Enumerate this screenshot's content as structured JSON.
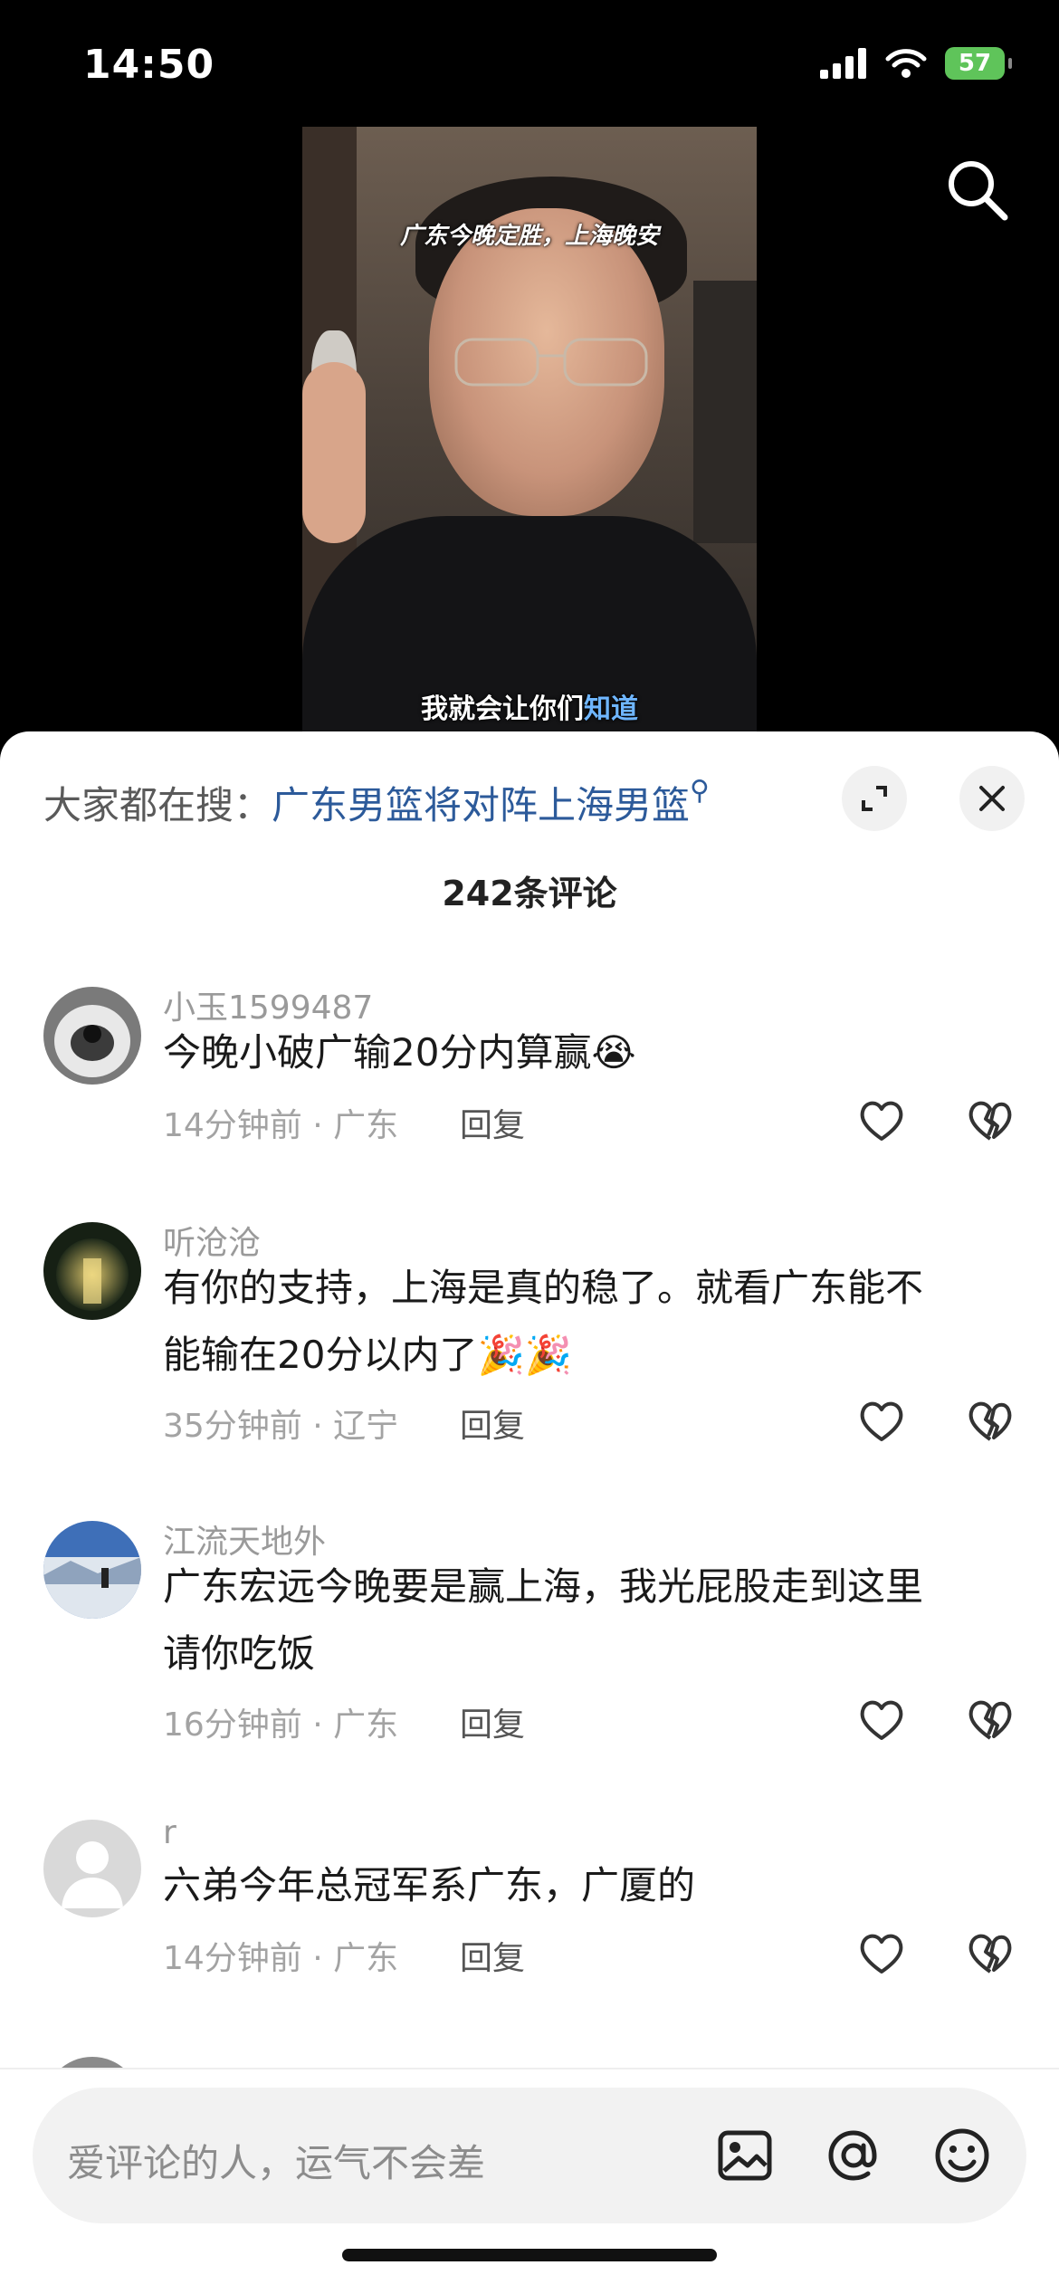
{
  "status_bar": {
    "time": "14:50",
    "battery": "57",
    "battery_color": "#5fc45a"
  },
  "video": {
    "caption_top": "广东今晚定胜，上海晚安",
    "caption_bottom_main": "我就会让你们",
    "caption_bottom_highlight": "知道"
  },
  "sheet": {
    "hot_search_prefix": "大家都在搜：",
    "hot_search_link": "广东男篮将对阵上海男篮",
    "comment_count": "242条评论"
  },
  "comments": [
    {
      "name": "小玉1599487",
      "lines": [
        "今晚小破广输20分内算赢😭"
      ],
      "time_loc": "14分钟前 · 广东",
      "reply": "回复"
    },
    {
      "name": "听沧沧",
      "lines": [
        "有你的支持，上海是真的稳了。就看广东能不",
        "能输在20分以内了🎉🎉"
      ],
      "time_loc": "35分钟前 · 辽宁",
      "reply": "回复"
    },
    {
      "name": "江流天地外",
      "lines": [
        "广东宏远今晚要是赢上海，我光屁股走到这里",
        "请你吃饭"
      ],
      "time_loc": "16分钟前 · 广东",
      "reply": "回复"
    },
    {
      "name": "r",
      "lines": [
        "六弟今年总冠军系广东，广厦的"
      ],
      "time_loc": "14分钟前 · 广东",
      "reply": "回复"
    }
  ],
  "input": {
    "placeholder": "爱评论的人，运气不会差"
  },
  "icons": {
    "search": "search-icon",
    "expand": "expand-icon",
    "close": "close-icon",
    "like": "heart-icon",
    "dislike": "broken-heart-icon",
    "image": "image-icon",
    "mention": "at-icon",
    "emoji": "emoji-icon"
  }
}
